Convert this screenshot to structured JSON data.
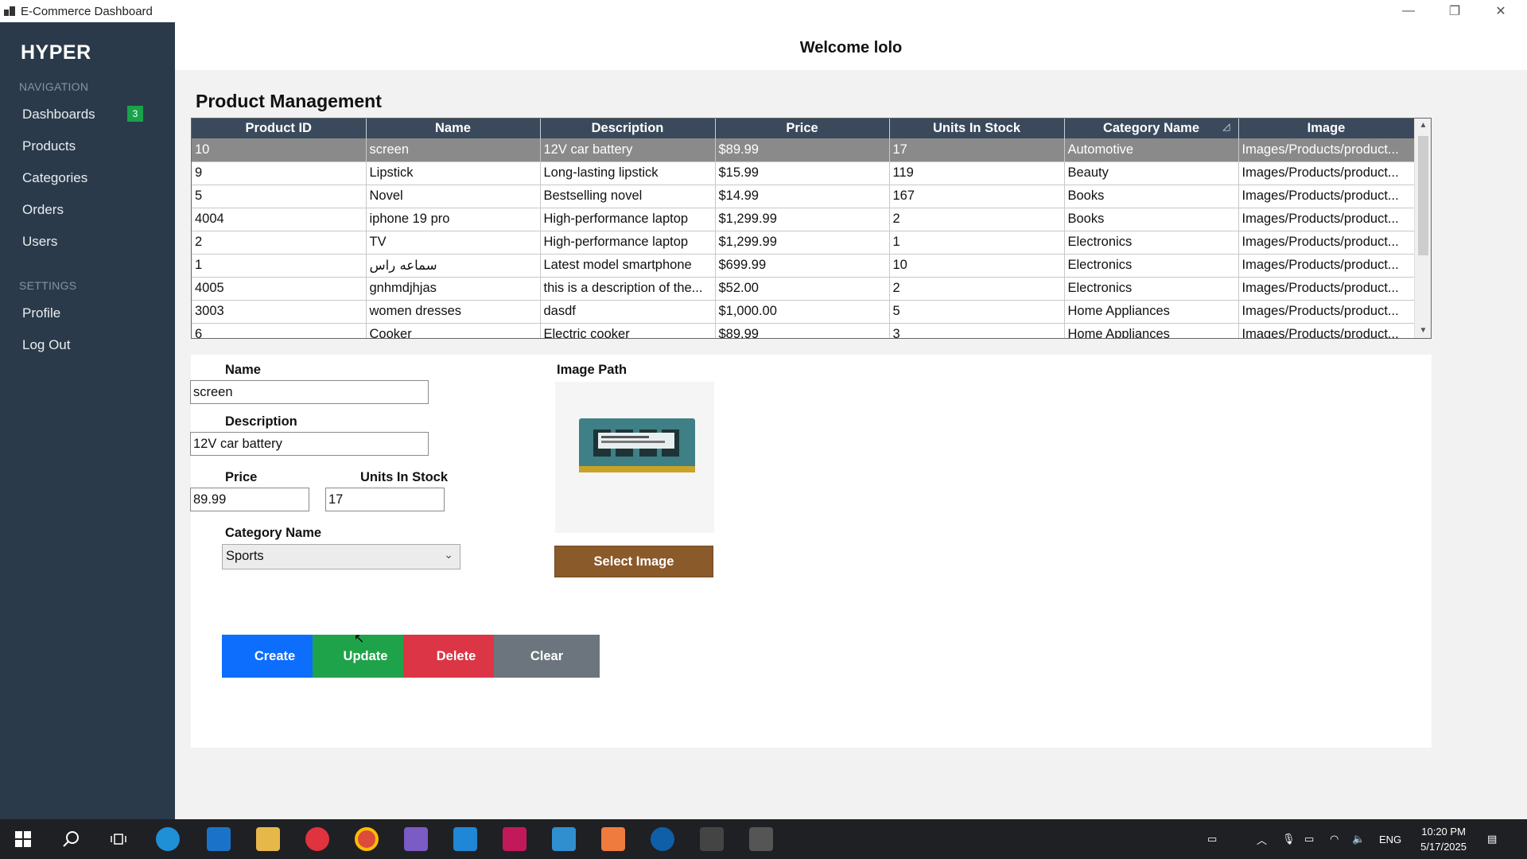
{
  "window": {
    "title": "E-Commerce Dashboard"
  },
  "sidebar": {
    "brand": "HYPER",
    "navigation_header": "NAVIGATION",
    "items": [
      {
        "label": "Dashboards",
        "badge": "3"
      },
      {
        "label": "Products"
      },
      {
        "label": "Categories"
      },
      {
        "label": "Orders"
      },
      {
        "label": "Users"
      }
    ],
    "settings_header": "SETTINGS",
    "settings_items": [
      {
        "label": "Profile"
      },
      {
        "label": "Log Out"
      }
    ]
  },
  "header": {
    "welcome": "Welcome lolo"
  },
  "page": {
    "title": "Product Management"
  },
  "grid": {
    "columns": [
      "Product ID",
      "Name",
      "Description",
      "Price",
      "Units In Stock",
      "Category Name",
      "Image"
    ],
    "sort_icon": "sort-descending-icon",
    "rows": [
      {
        "id": "10",
        "name": "screen",
        "description": "12V car battery",
        "price": "$89.99",
        "stock": "17",
        "category": "Automotive",
        "image": "Images/Products/product...",
        "selected": true
      },
      {
        "id": "9",
        "name": "Lipstick",
        "description": "Long-lasting lipstick",
        "price": "$15.99",
        "stock": "119",
        "category": "Beauty",
        "image": "Images/Products/product..."
      },
      {
        "id": "5",
        "name": "Novel",
        "description": "Bestselling novel",
        "price": "$14.99",
        "stock": "167",
        "category": "Books",
        "image": "Images/Products/product..."
      },
      {
        "id": "4004",
        "name": "iphone 19 pro",
        "description": "High-performance laptop",
        "price": "$1,299.99",
        "stock": "2",
        "category": "Books",
        "image": "Images/Products/product..."
      },
      {
        "id": "2",
        "name": "TV",
        "description": "High-performance laptop",
        "price": "$1,299.99",
        "stock": "1",
        "category": "Electronics",
        "image": "Images/Products/product..."
      },
      {
        "id": "1",
        "name": "سماعه راس",
        "description": "Latest model smartphone",
        "price": "$699.99",
        "stock": "10",
        "category": "Electronics",
        "image": "Images/Products/product..."
      },
      {
        "id": "4005",
        "name": "gnhmdjhjas",
        "description": "this is a description of the...",
        "price": "$52.00",
        "stock": "2",
        "category": "Electronics",
        "image": "Images/Products/product..."
      },
      {
        "id": "3003",
        "name": "women dresses",
        "description": "dasdf",
        "price": "$1,000.00",
        "stock": "5",
        "category": "Home Appliances",
        "image": "Images/Products/product..."
      },
      {
        "id": "6",
        "name": "Cooker",
        "description": "Electric cooker",
        "price": "$89.99",
        "stock": "3",
        "category": "Home Appliances",
        "image": "Images/Products/product..."
      }
    ]
  },
  "form": {
    "name_label": "Name",
    "name_value": "screen",
    "description_label": "Description",
    "description_value": "12V car battery",
    "price_label": "Price",
    "price_value": "89.99",
    "stock_label": "Units In Stock",
    "stock_value": "17",
    "category_label": "Category Name",
    "category_value": "Sports",
    "image_label": "Image Path",
    "select_image": "Select Image"
  },
  "buttons": {
    "create": "Create",
    "update": "Update",
    "delete": "Delete",
    "clear": "Clear"
  },
  "colors": {
    "sidebar": "#2b3a4a",
    "header": "#3a4a5c",
    "create": "#0d6efd",
    "update": "#1fa34a",
    "delete": "#dc3545",
    "clear": "#6c757d",
    "select_image": "#8b5a2b",
    "badge": "#17a34a"
  },
  "taskbar": {
    "lang": "ENG",
    "time": "10:20 PM",
    "date": "5/17/2025"
  }
}
